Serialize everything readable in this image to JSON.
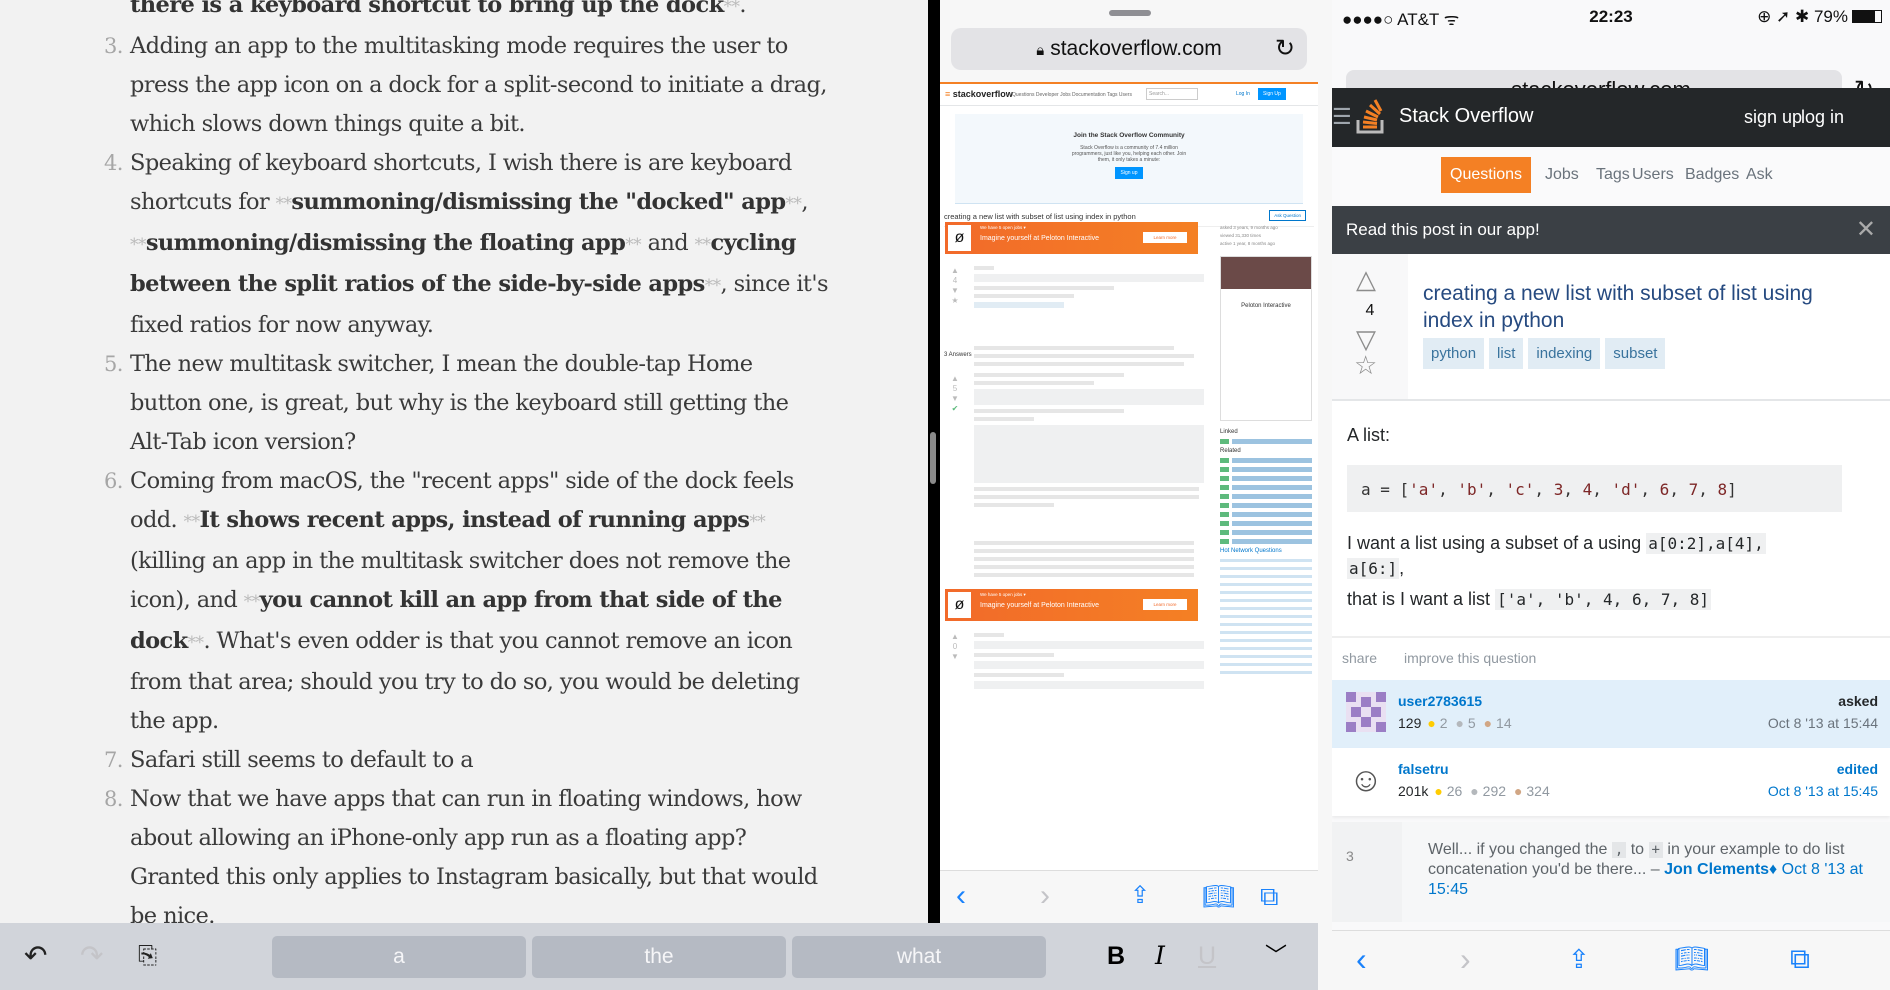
{
  "editor": {
    "items": [
      {
        "num": "",
        "segments": [
          {
            "t": "there is a keyboard shortcut to bring up the dock",
            "b": true
          },
          {
            "t": "**",
            "md": true
          },
          {
            "t": "."
          }
        ]
      },
      {
        "num": "3.",
        "segments": [
          {
            "t": "Adding an app to the multitasking mode requires the user to press the app icon on a dock for a split-second to initiate a drag, which slows down things quite a bit."
          }
        ]
      },
      {
        "num": "4.",
        "segments": [
          {
            "t": "Speaking of keyboard shortcuts, I wish there is are keyboard shortcuts for "
          },
          {
            "t": "**",
            "md": true
          },
          {
            "t": "summoning/dismissing the \"docked\" app",
            "b": true
          },
          {
            "t": "**",
            "md": true
          },
          {
            "t": ", "
          },
          {
            "t": "**",
            "md": true
          },
          {
            "t": "summoning/dismissing the floating app",
            "b": true
          },
          {
            "t": "**",
            "md": true
          },
          {
            "t": " and "
          },
          {
            "t": "**",
            "md": true
          },
          {
            "t": "cycling between the split ratios of the side-by-side apps",
            "b": true
          },
          {
            "t": "**",
            "md": true
          },
          {
            "t": ", since it's fixed ratios for now anyway."
          }
        ]
      },
      {
        "num": "5.",
        "segments": [
          {
            "t": "The new multitask switcher, I mean the double-tap Home button one, is great, but why is the keyboard still getting the Alt-Tab icon version?"
          }
        ]
      },
      {
        "num": "6.",
        "segments": [
          {
            "t": "Coming from macOS, the \"recent apps\" side of the dock feels odd. "
          },
          {
            "t": "**",
            "md": true
          },
          {
            "t": "It shows recent apps, instead of running apps",
            "b": true
          },
          {
            "t": "**",
            "md": true
          },
          {
            "t": " (killing an app in the multitask switcher does not remove the icon), and "
          },
          {
            "t": "**",
            "md": true
          },
          {
            "t": "you cannot kill an app from that side of the dock",
            "b": true
          },
          {
            "t": "**",
            "md": true
          },
          {
            "t": ". What's even odder is that you cannot remove an icon from that area; should you try to do so, you would be deleting the app."
          }
        ]
      },
      {
        "num": "7.",
        "segments": [
          {
            "t": "Safari still seems to default to a"
          }
        ]
      },
      {
        "num": "8.",
        "segments": [
          {
            "t": "Now that we have apps that can run in floating windows, how about allowing an iPhone-only app run as a floating app? Granted this only applies to Instagram basically, but that would be nice."
          }
        ]
      }
    ]
  },
  "keyboard_bar": {
    "undo_icon": "undo-icon",
    "redo_icon": "redo-icon",
    "paste_icon": "clipboard-icon",
    "suggestions": [
      "a",
      "the",
      "what"
    ],
    "bold": "B",
    "italic": "I",
    "underline": "U",
    "dismiss_icon": "chevron-down-icon"
  },
  "slideover": {
    "url": "stackoverflow.com",
    "so_header": {
      "logo": "stackoverflow",
      "nav": "Questions   Developer Jobs   Documentation   Tags   Users",
      "search_placeholder": "Search...",
      "login": "Log In",
      "signup": "Sign Up"
    },
    "join": {
      "title": "Join the Stack Overflow Community",
      "text": "Stack Overflow is a community of 7.4 million programmers, just like you, helping each other. Join them, it only takes a minute:",
      "button": "Sign up"
    },
    "question_title": "creating a new list with subset of list using index in python",
    "ask_button": "Ask Question",
    "ad": {
      "jobs": "We have 5 open jobs ▾",
      "text": "Imagine yourself at Peloton Interactive",
      "button": "Learn more"
    },
    "stats": [
      "asked  3 years, 9 months ago",
      "viewed  31,330 times",
      "active  1 year, 8 months ago"
    ],
    "company": "Peloton Interactive",
    "answers_header": "3 Answers",
    "linked_header": "Linked",
    "related_header": "Related",
    "hot_header": "Hot Network Questions",
    "vote_counts": [
      "4",
      "5",
      "0"
    ]
  },
  "phone": {
    "status": {
      "carrier": "●●●●○ AT&T ᯤ",
      "time": "22:23",
      "battery": "⊕ ➚ ✱ 79%"
    },
    "url": "stackoverflow.com",
    "header": {
      "brand": "Stack Overflow",
      "signup": "sign up",
      "login": "log in"
    },
    "nav": [
      "Questions",
      "Jobs",
      "Tags",
      "Users",
      "Badges",
      "Ask"
    ],
    "banner": "Read this post in our app!",
    "question": {
      "score": "4",
      "title": "creating a new list with subset of list using index in python",
      "tags": [
        "python",
        "list",
        "indexing",
        "subset"
      ],
      "intro": "A list:",
      "code": "a = ['a', 'b', 'c', 3, 4, 'd', 6, 7, 8]",
      "want_text": "I want a list using a subset of a using",
      "want_code1": "a[0:2],a[4],",
      "want_code2": "a[6:]",
      "result_text": "that is I want a list",
      "result_code": "['a', 'b', 4, 6, 7, 8]"
    },
    "actions": [
      "share",
      "improve this question"
    ],
    "signatures": [
      {
        "name": "user2783615",
        "rep": "129",
        "gold": "2",
        "silver": "5",
        "bronze": "14",
        "action": "asked",
        "date": "Oct 8 '13 at 15:44"
      },
      {
        "name": "falsetru",
        "rep": "201k",
        "gold": "26",
        "silver": "292",
        "bronze": "324",
        "action": "edited",
        "date": "Oct 8 '13 at 15:45"
      }
    ],
    "comment": {
      "score": "3",
      "text1": "Well... if you changed the",
      "code1": ",",
      "text2": "to",
      "code2": "+",
      "text3": "in your example to do list concatenation you'd be there... –",
      "author": "Jon Clements",
      "mod": "♦",
      "date": "Oct 8 '13 at 15:45"
    }
  },
  "colors": {
    "so_orange": "#f48024",
    "ios_blue": "#1a82fb",
    "so_link": "#0077cc",
    "tag_bg": "#e1ecf4"
  }
}
